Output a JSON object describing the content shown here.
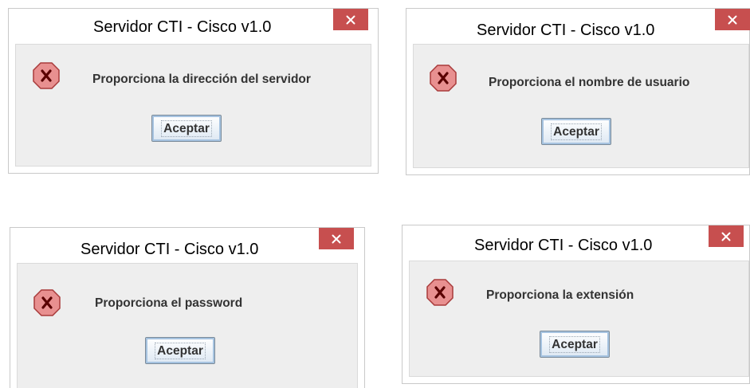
{
  "dialogs": [
    {
      "title": "Servidor CTI - Cisco  v1.0",
      "message": "Proporciona la dirección del servidor",
      "button_label": "Aceptar",
      "close_glyph": "✕",
      "icon": "error-icon",
      "icon_letter": "X"
    },
    {
      "title": "Servidor CTI - Cisco  v1.0",
      "message": "Proporciona el nombre de usuario",
      "button_label": "Aceptar",
      "close_glyph": "✕",
      "icon": "error-icon",
      "icon_letter": "X"
    },
    {
      "title": "Servidor CTI - Cisco  v1.0",
      "message": "Proporciona el password",
      "button_label": "Aceptar",
      "close_glyph": "✕",
      "icon": "error-icon",
      "icon_letter": "X"
    },
    {
      "title": "Servidor CTI - Cisco  v1.0",
      "message": "Proporciona la extensión",
      "button_label": "Aceptar",
      "close_glyph": "✕",
      "icon": "error-icon",
      "icon_letter": "X"
    }
  ],
  "colors": {
    "close_button": "#c74f4f",
    "error_icon_fill": "#e89090",
    "error_icon_stroke": "#a83a3a",
    "content_background": "#eeeeee"
  }
}
